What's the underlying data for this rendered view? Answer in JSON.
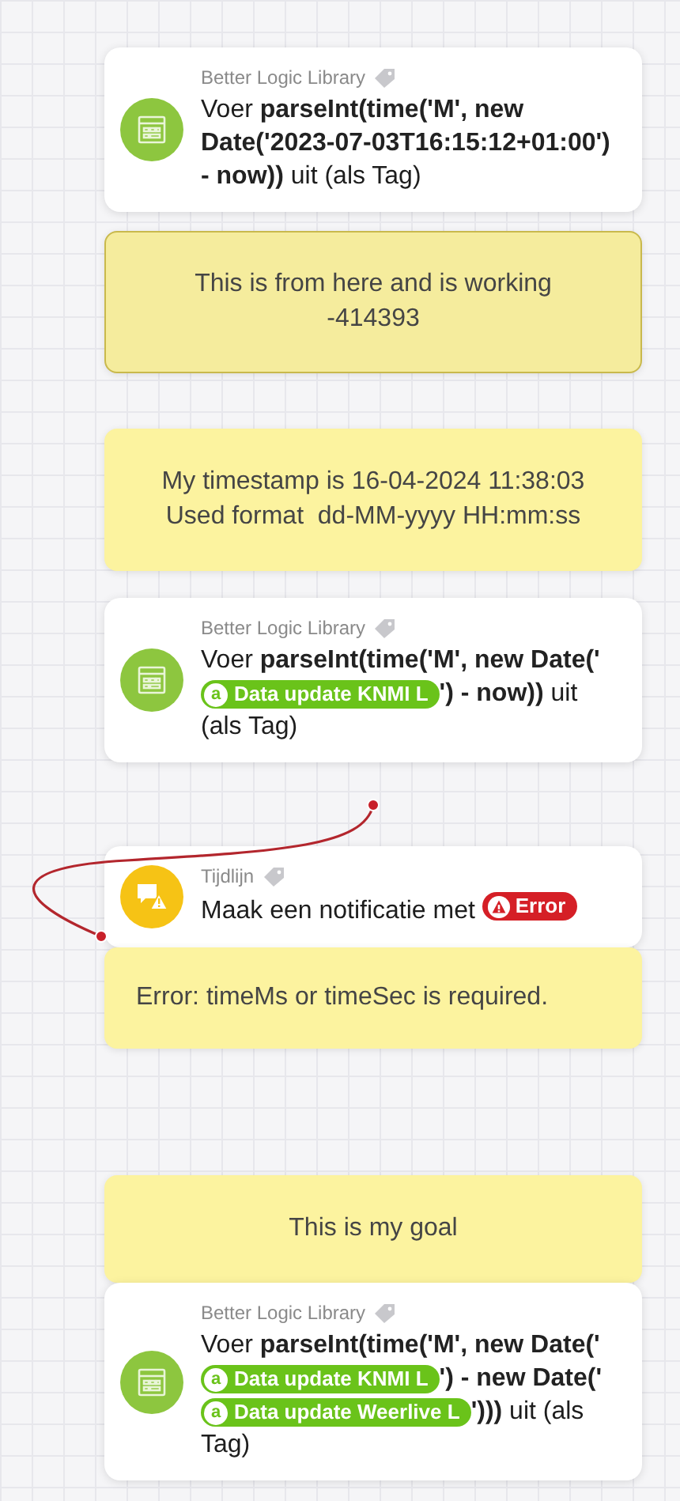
{
  "groups": [
    {
      "items": [
        {
          "kind": "library-card",
          "category": "Better Logic Library",
          "segments": [
            {
              "kind": "plain",
              "text": "Voer "
            },
            {
              "kind": "code",
              "text": "parseInt(time('M', new Date('2023-07-03T16:15:12+01:00') - now))"
            },
            {
              "kind": "plain",
              "text": " uit (als Tag)"
            }
          ]
        }
      ]
    },
    {
      "items": [
        {
          "kind": "note",
          "selected": true,
          "lines": [
            "This is from here and is working",
            "-414393"
          ]
        }
      ]
    },
    {
      "items": [
        {
          "kind": "note",
          "selected": false,
          "lines": [
            "My timestamp is 16-04-2024 11:38:03",
            "Used format  dd-MM-yyyy HH:mm:ss"
          ]
        }
      ]
    },
    {
      "items": [
        {
          "kind": "library-card",
          "category": "Better Logic Library",
          "segments": [
            {
              "kind": "plain",
              "text": "Voer "
            },
            {
              "kind": "code",
              "text": "parseInt(time('M', new Date('"
            },
            {
              "kind": "tag",
              "letter": "a",
              "text": "Data update KNMI L"
            },
            {
              "kind": "code",
              "text": "') - now))"
            },
            {
              "kind": "plain",
              "text": " uit (als Tag)"
            }
          ]
        }
      ]
    },
    {
      "items": [
        {
          "kind": "timeline-card",
          "category": "Tijdlijn",
          "segments": [
            {
              "kind": "plain",
              "text": "Maak een notificatie met "
            },
            {
              "kind": "error",
              "text": "Error"
            }
          ]
        },
        {
          "kind": "error-note",
          "selected": false,
          "lines": [
            "Error: timeMs or timeSec is required."
          ]
        }
      ]
    },
    {
      "items": [
        {
          "kind": "note",
          "selected": false,
          "lines": [
            "This is my goal"
          ]
        },
        {
          "kind": "library-card",
          "category": "Better Logic Library",
          "segments": [
            {
              "kind": "plain",
              "text": "Voer "
            },
            {
              "kind": "code",
              "text": "parseInt(time('M', new Date('"
            },
            {
              "kind": "tag",
              "letter": "a",
              "text": "Data update KNMI L"
            },
            {
              "kind": "code",
              "text": "') - new Date('"
            },
            {
              "kind": "tag",
              "letter": "a",
              "text": "Data update Weerlive L"
            },
            {
              "kind": "code",
              "text": "')))"
            },
            {
              "kind": "plain",
              "text": " uit (als Tag)"
            }
          ]
        }
      ]
    }
  ]
}
